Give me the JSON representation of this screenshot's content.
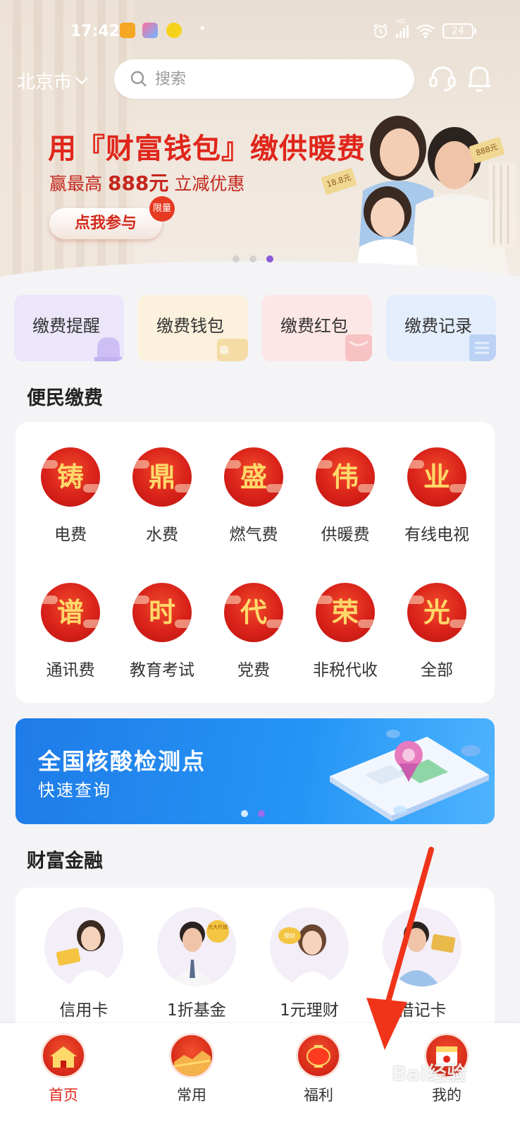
{
  "status_bar": {
    "time": "17:42",
    "battery": "24",
    "network_label": "HD"
  },
  "header": {
    "city": "北京市",
    "search_placeholder": "搜索"
  },
  "hero": {
    "title": "用『财富钱包』缴供暖费",
    "subtitle_prefix": "赢最高",
    "subtitle_amount": "888元",
    "subtitle_suffix": "立减优惠",
    "cta": "点我参与",
    "tag": "限量",
    "coin_left": "18.8元",
    "coin_right": "888元",
    "page_count": 3,
    "active_page": 3
  },
  "quick_cards": [
    {
      "label": "缴费提醒",
      "bg": "#ece6fb",
      "accent": "#cdbff4"
    },
    {
      "label": "缴费钱包",
      "bg": "#fbf1dc",
      "accent": "#f5dca6"
    },
    {
      "label": "缴费红包",
      "bg": "#fde6e6",
      "accent": "#f7c2c2"
    },
    {
      "label": "缴费记录",
      "bg": "#e4edfb",
      "accent": "#bcd2f4"
    }
  ],
  "convenience": {
    "title": "便民缴费",
    "items": [
      {
        "char": "铸",
        "label": "电费"
      },
      {
        "char": "鼎",
        "label": "水费"
      },
      {
        "char": "盛",
        "label": "燃气费"
      },
      {
        "char": "伟",
        "label": "供暖费"
      },
      {
        "char": "业",
        "label": "有线电视"
      },
      {
        "char": "谱",
        "label": "通讯费"
      },
      {
        "char": "时",
        "label": "教育考试"
      },
      {
        "char": "代",
        "label": "党费"
      },
      {
        "char": "荣",
        "label": "非税代收"
      },
      {
        "char": "光",
        "label": "全部"
      }
    ]
  },
  "covid_banner": {
    "title": "全国核酸检测点",
    "subtitle": "快速查询",
    "page_count": 2,
    "active_page": 2
  },
  "finance": {
    "title": "财富金融",
    "items": [
      {
        "label": "信用卡",
        "badge": ""
      },
      {
        "label": "1折基金",
        "badge": "光大代销"
      },
      {
        "label": "1元理财",
        "badge": "理财"
      },
      {
        "label": "借记卡",
        "badge": ""
      }
    ]
  },
  "tabbar": [
    {
      "label": "首页",
      "active": true
    },
    {
      "label": "常用",
      "active": false
    },
    {
      "label": "福利",
      "active": false
    },
    {
      "label": "我的",
      "active": false
    }
  ],
  "watermark": "Bai经验",
  "colors": {
    "brand_red": "#e3271b",
    "indicator_purple": "#8a5bd6",
    "covid_blue": "#2595f5",
    "annotation_arrow": "#f0341a"
  }
}
